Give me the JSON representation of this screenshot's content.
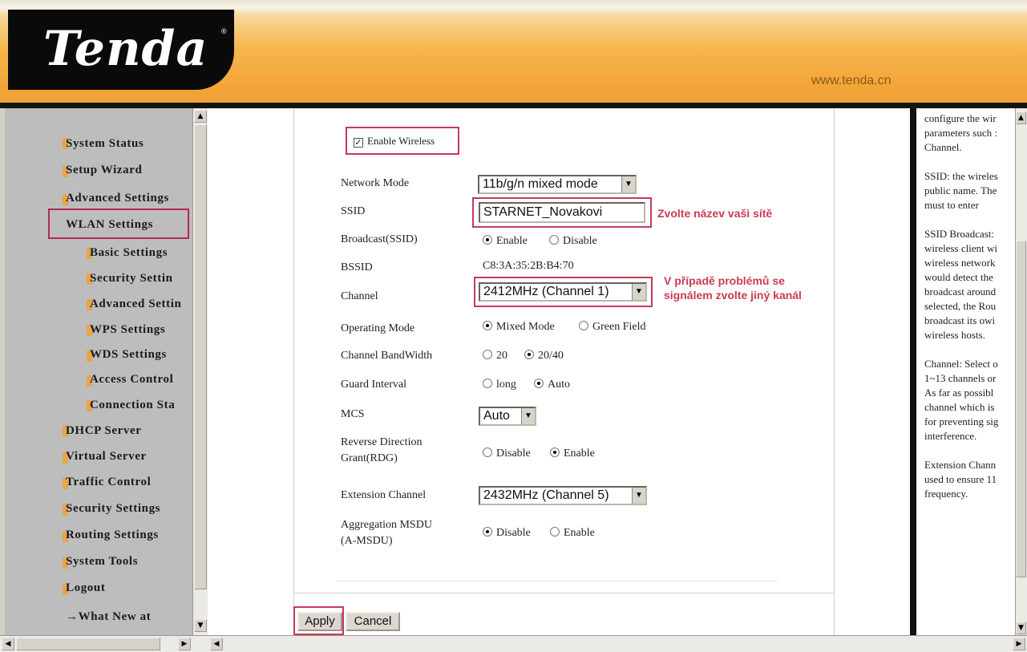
{
  "header": {
    "logo_text": "Tenda",
    "logo_reg": "®",
    "url": "www.tenda.cn"
  },
  "nav": {
    "items": [
      {
        "label": "System Status"
      },
      {
        "label": "Setup Wizard"
      },
      {
        "label": "Advanced Settings"
      },
      {
        "label": "WLAN Settings"
      },
      {
        "label": "Basic Settings"
      },
      {
        "label": "Security Settin"
      },
      {
        "label": "Advanced Settin"
      },
      {
        "label": "WPS Settings"
      },
      {
        "label": "WDS Settings"
      },
      {
        "label": "Access Control"
      },
      {
        "label": "Connection Sta"
      },
      {
        "label": "DHCP Server"
      },
      {
        "label": "Virtual Server"
      },
      {
        "label": "Traffic Control"
      },
      {
        "label": "Security Settings"
      },
      {
        "label": "Routing Settings"
      },
      {
        "label": "System Tools"
      },
      {
        "label": "Logout"
      },
      {
        "label": "→What New at"
      }
    ]
  },
  "form": {
    "enable_wireless": "Enable Wireless",
    "network_mode": {
      "label": "Network Mode",
      "value": "11b/g/n mixed mode"
    },
    "ssid": {
      "label": "SSID",
      "value": "STARNET_Novakovi",
      "note": "Zvolte název vaši sítě"
    },
    "broadcast": {
      "label": "Broadcast(SSID)",
      "opt1": "Enable",
      "opt2": "Disable"
    },
    "bssid": {
      "label": "BSSID",
      "value": "C8:3A:35:2B:B4:70"
    },
    "channel": {
      "label": "Channel",
      "value": "2412MHz (Channel 1)",
      "note1": "V případě problémů se",
      "note2": "signálem zvolte  jiný kanál"
    },
    "operating_mode": {
      "label": "Operating Mode",
      "opt1": "Mixed Mode",
      "opt2": "Green Field"
    },
    "bandwidth": {
      "label": "Channel BandWidth",
      "opt1": "20",
      "opt2": "20/40"
    },
    "guard": {
      "label": "Guard Interval",
      "opt1": "long",
      "opt2": "Auto"
    },
    "mcs": {
      "label": "MCS",
      "value": "Auto"
    },
    "rdg": {
      "label1": "Reverse Direction",
      "label2": "Grant(RDG)",
      "opt1": "Disable",
      "opt2": "Enable"
    },
    "ext_channel": {
      "label": "Extension Channel",
      "value": "2432MHz (Channel 5)"
    },
    "amsdu": {
      "label1": "Aggregation MSDU",
      "label2": "(A-MSDU)",
      "opt1": "Disable",
      "opt2": "Enable"
    },
    "apply": "Apply",
    "cancel": "Cancel"
  },
  "help": {
    "lines": [
      "configure the wir",
      "parameters such :",
      "Channel.",
      "SSID: the wireles",
      "public name. The",
      "must to enter",
      "SSID Broadcast:",
      "wireless client wi",
      "wireless network",
      "would detect the",
      "broadcast around",
      "selected, the Rou",
      "broadcast its owi",
      "wireless hosts.",
      "Channel: Select o",
      "1~13 channels or",
      "As far as possibl",
      "channel which is",
      "for preventing sig",
      "interference.",
      "Extension Chann",
      "used to ensure 11",
      "frequency."
    ]
  },
  "colors": {
    "header_orange": "#f3a436",
    "highlight_red": "#c43a5e",
    "note_red": "#cc3b55",
    "nav_bg": "#bdbdbd"
  }
}
